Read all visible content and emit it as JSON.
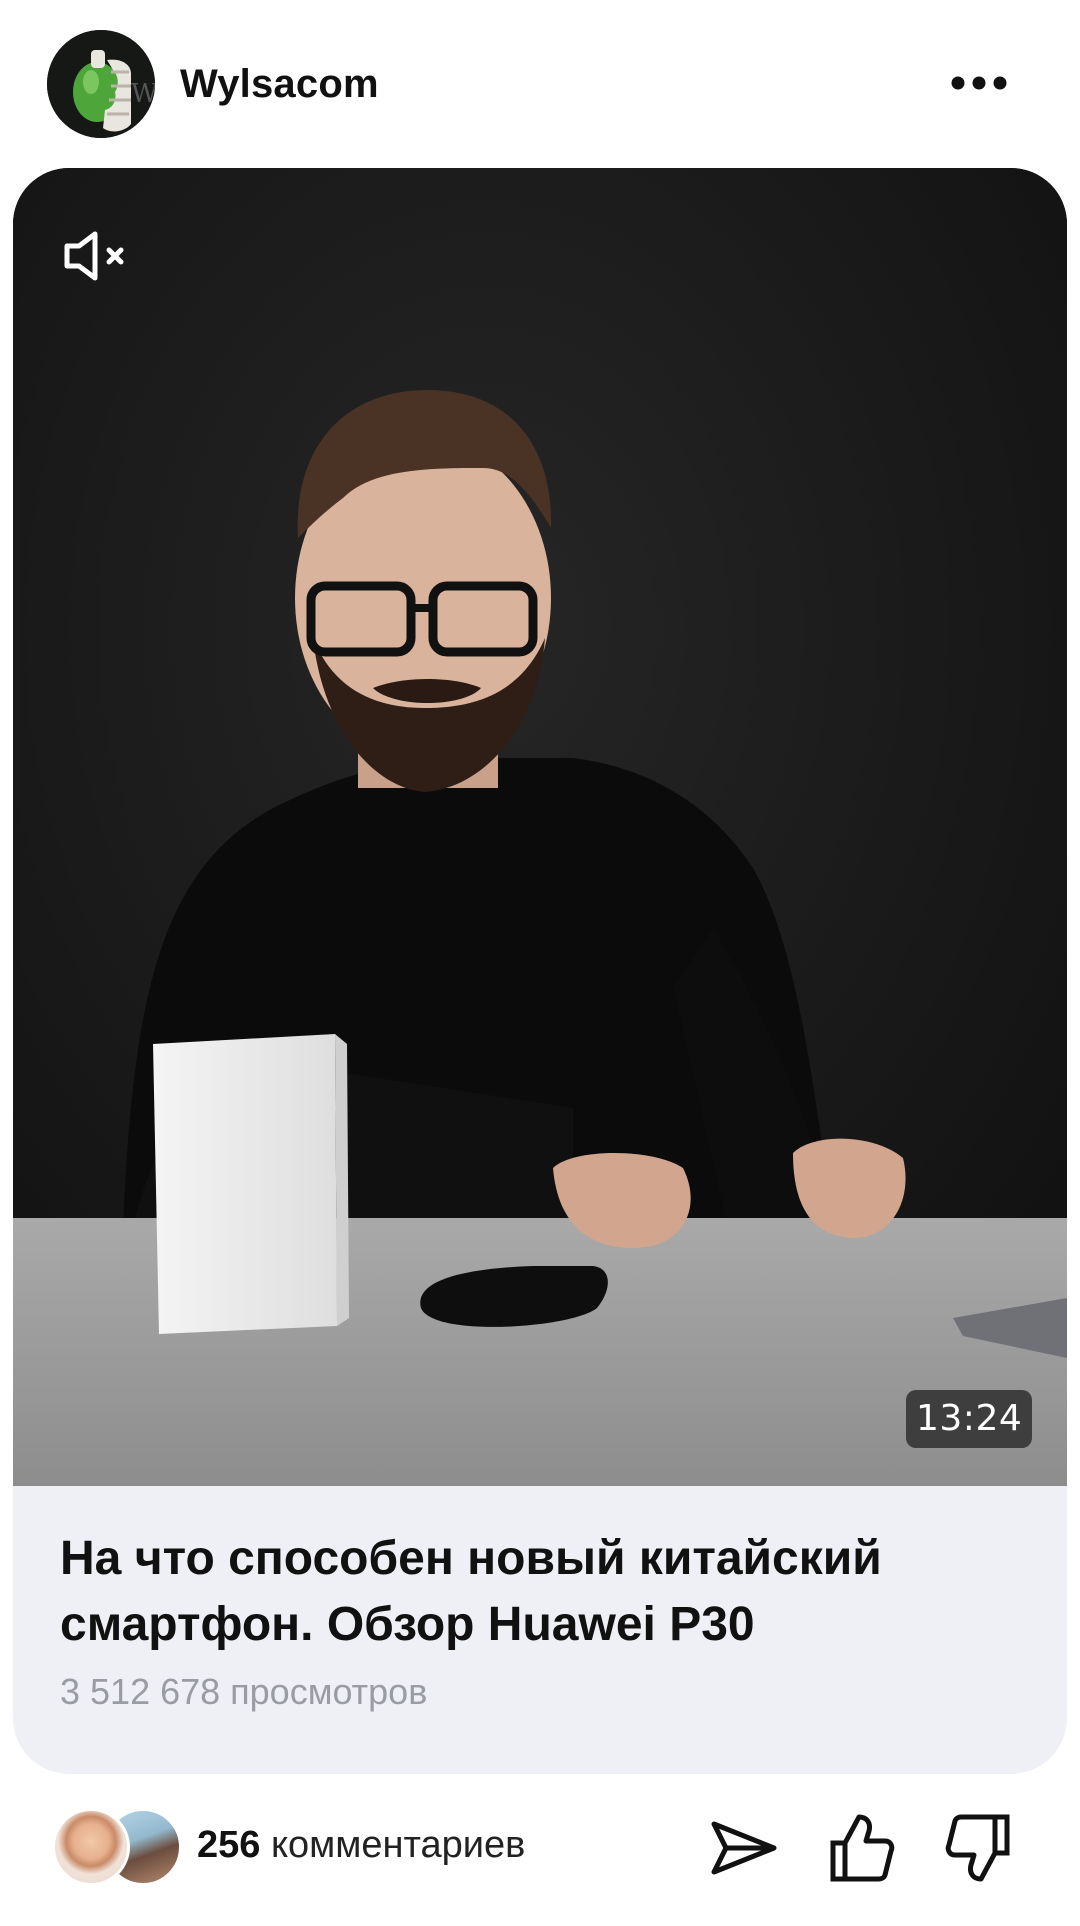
{
  "post": {
    "author": "Wylsacom",
    "avatar_icon": "avatar-hand-apple",
    "more_icon": "more-dots-icon"
  },
  "video": {
    "duration": "13:24",
    "mute_icon": "volume-muted-icon",
    "title": "На что способен новый китайский смартфон. Обзор Huawei P30",
    "views": "3 512 678 просмотров"
  },
  "footer": {
    "comments_count": "256",
    "comments_label": "комментариев",
    "share_icon": "send-icon",
    "like_icon": "thumb-up-icon",
    "dislike_icon": "thumb-down-icon"
  },
  "colors": {
    "card_background": "#eef0f5",
    "text_primary": "#111111",
    "text_secondary": "#9a9ca3",
    "badge_background": "#323232"
  }
}
